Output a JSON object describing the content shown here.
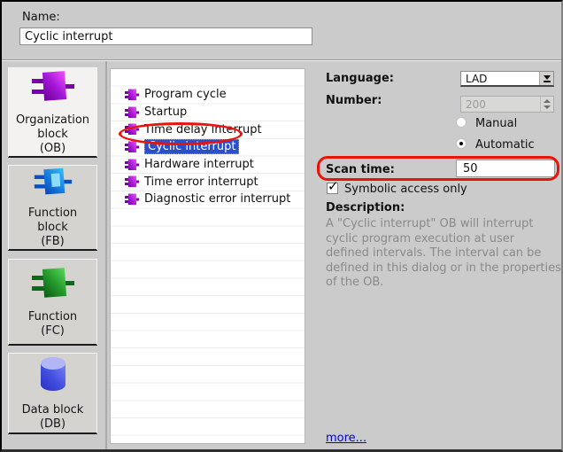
{
  "name_field": {
    "label": "Name:",
    "value": "Cyclic interrupt"
  },
  "sidebar": {
    "buttons": [
      {
        "id": "ob",
        "lines": [
          "Organization",
          "block",
          "(OB)"
        ],
        "selected": true,
        "icon": "organization-block-icon"
      },
      {
        "id": "fb",
        "lines": [
          "Function",
          "block",
          "(FB)"
        ],
        "selected": false,
        "icon": "function-block-icon"
      },
      {
        "id": "fc",
        "lines": [
          "Function",
          "(FC)"
        ],
        "selected": false,
        "icon": "function-icon"
      },
      {
        "id": "db",
        "lines": [
          "Data block",
          "(DB)"
        ],
        "selected": false,
        "icon": "data-block-icon"
      }
    ]
  },
  "list": {
    "items": [
      {
        "label": "Program cycle",
        "selected": false
      },
      {
        "label": "Startup",
        "selected": false
      },
      {
        "label": "Time delay interrupt",
        "selected": false
      },
      {
        "label": "Cyclic interrupt",
        "selected": true,
        "annotated": true
      },
      {
        "label": "Hardware interrupt",
        "selected": false
      },
      {
        "label": "Time error interrupt",
        "selected": false
      },
      {
        "label": "Diagnostic error interrupt",
        "selected": false
      }
    ]
  },
  "properties": {
    "language": {
      "label": "Language:",
      "value": "LAD"
    },
    "number": {
      "label": "Number:",
      "value": "200",
      "disabled": true
    },
    "numbering_options": [
      {
        "label": "Manual",
        "selected": false
      },
      {
        "label": "Automatic",
        "selected": true
      }
    ],
    "scan_time": {
      "label": "Scan time:",
      "value": "50",
      "annotated": true
    },
    "symbolic_access": {
      "label": "Symbolic access only",
      "checked": true
    },
    "description": {
      "label": "Description:",
      "text": "A \"Cyclic interrupt\" OB will interrupt cyclic program execution at user defined intervals. The interval can be defined in this dialog or in the properties of the OB."
    },
    "more_link": "more..."
  },
  "colors": {
    "selection_blue": "#2950c8",
    "annotation_red": "#e8140c",
    "window_gray": "#cbcbcb"
  }
}
